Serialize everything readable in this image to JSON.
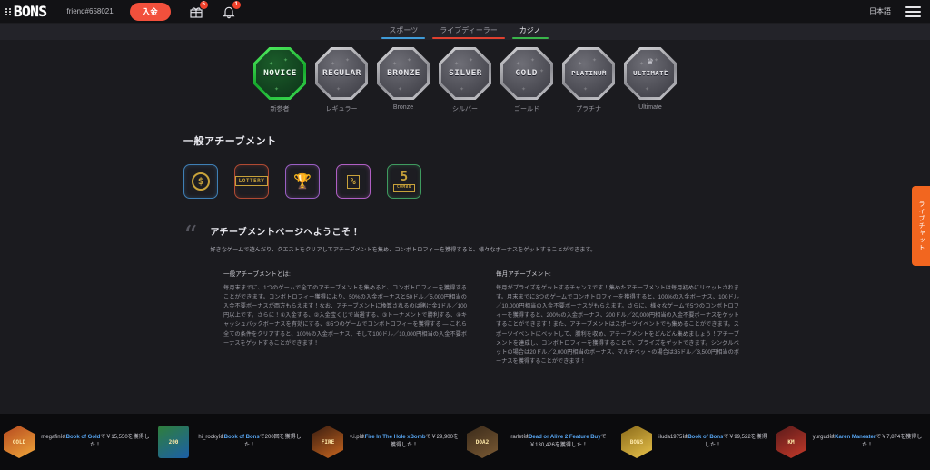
{
  "topbar": {
    "brand": "BONS",
    "friend_id": "friend#658021",
    "deposit_label": "入金",
    "gift_icon": "gift-icon",
    "gift_badge": "5",
    "bell_icon": "bell-icon",
    "bell_badge": "1",
    "language": "日本語",
    "menu_icon": "hamburger-menu-icon"
  },
  "nav": {
    "tabs": [
      {
        "label": "スポーツ",
        "color": "#3f9bd8",
        "active": false
      },
      {
        "label": "ライブディーラー",
        "color": "#e0402f",
        "active": false
      },
      {
        "label": "カジノ",
        "color": "#39b54a",
        "active": true
      }
    ]
  },
  "ranks": [
    {
      "badge": "NOVICE",
      "name": "新参者",
      "active": true
    },
    {
      "badge": "REGULAR",
      "name": "レギュラー",
      "active": false
    },
    {
      "badge": "BRONZE",
      "name": "Bronze",
      "active": false
    },
    {
      "badge": "SILVER",
      "name": "シルバー",
      "active": false
    },
    {
      "badge": "GOLD",
      "name": "ゴールド",
      "active": false
    },
    {
      "badge": "PLATINUM",
      "name": "プラチナ",
      "active": false
    },
    {
      "badge": "ULTIMATE",
      "name": "Ultimate",
      "active": false
    }
  ],
  "achievements": {
    "title": "一般アチーブメント",
    "items": [
      {
        "name": "deposit-achievement",
        "glyph": "$",
        "caption": "",
        "color": "#3f7fb5"
      },
      {
        "name": "lottery-achievement",
        "glyph": "",
        "caption": "LOTTERY",
        "color": "#b04a33"
      },
      {
        "name": "tournament-achievement",
        "glyph": "1",
        "caption": "",
        "color": "#9b5fc4"
      },
      {
        "name": "cashback-achievement",
        "glyph": "%",
        "caption": "",
        "color": "#b05fc4"
      },
      {
        "name": "combo-achievement",
        "glyph": "5",
        "caption": "COMBO",
        "color": "#3f9b5f"
      }
    ]
  },
  "intro": {
    "quote_mark": "“",
    "title": "アチーブメントページへようこそ！",
    "subtitle": "好きなゲームで遊んだり、クエストをクリアしてアチーブメントを集め、コンボトロフィーを獲得すると、様々なボーナスをゲットすることができます。"
  },
  "columns": [
    {
      "heading": "一般アチーブメントとは:",
      "body": "毎月末までに、1つのゲームで全てのアチーブメントを集めると、コンボトロフィーを獲得することができます。コンボトロフィー獲得により、50%の入金ボーナスと50ドル／5,000円相当の入金不要ボーナスが両方もらえます！なお、アチーブメントに換算されるのは賭け金1ドル／100円以上です。さらに！①入金する、②入金宝くじで当選する、③トーナメントで勝利する、④キャッシュバックボーナスを有効にする、⑤5つのゲームでコンボトロフィーを獲得する ― これら全ての条件をクリアすると、100%の入金ボーナス、そして100ドル／10,000円相当の入金不要ボーナスをゲットすることができます！"
    },
    {
      "heading": "毎月アチーブメント:",
      "body": "毎月がプライズをゲットするチャンスです！集めたアチーブメントは毎月初めにリセットされます。月末までに3つのゲームでコンボトロフィーを獲得すると、100%の入金ボーナス、100ドル／10,000円相当の入金不要ボーナスがもらえます。さらに、様々なゲームで5つのコンボトロフィーを獲得すると、200%の入金ボーナス、200ドル／20,000円相当の入金不要ボーナスをゲットすることができます！また、アチーブメントはスポーツイベントでも集めることができます。スポーツイベントにベットして、勝利を収め、アチーブメントをどんどん集めましょう！アチーブメントを達成し、コンボトロフィーを獲得することで、プライズをゲットできます。シングルベットの場合は20ドル／2,000円相当のボーナス、マルチベットの場合は35ドル／3,500円相当のボーナスを獲得することができます！"
    }
  ],
  "side_tab": {
    "label": "ライブチャット"
  },
  "winners": [
    {
      "user": "megafin",
      "joiner": "は",
      "game": "Book of Gold",
      "tail": "で",
      "amount": "￥15,550",
      "suffix": "を獲得した！",
      "thumb": "GOLD",
      "shape": "hex",
      "bg1": "#b5491f",
      "bg2": "#f0a73a"
    },
    {
      "user": "hi_rocky",
      "joiner": "は",
      "game": "Book of Bons",
      "tail": "で",
      "amount": "200回",
      "suffix": "を獲得した！",
      "thumb": "200",
      "shape": "sq",
      "bg1": "#2f7f3a",
      "bg2": "#1c5fa8"
    },
    {
      "user": "v.i.p",
      "joiner": "は",
      "game": "Fire In The Hole xBomb",
      "tail": "で",
      "amount": "￥29,900",
      "suffix": "を獲得した！",
      "thumb": "FIRE",
      "shape": "hex",
      "bg1": "#3a1d10",
      "bg2": "#c8661f"
    },
    {
      "user": "rarlet",
      "joiner": "は",
      "game": "Dead or Alive 2 Feature Buy",
      "tail": "で",
      "amount": "￥130,426",
      "suffix": "を獲得した！",
      "thumb": "DOA2",
      "shape": "hex",
      "bg1": "#3a2a1a",
      "bg2": "#7a5a34"
    },
    {
      "user": "iluda1975",
      "joiner": "は",
      "game": "Book of Bons",
      "tail": "で",
      "amount": "￥99,522",
      "suffix": "を獲得した！",
      "thumb": "BONS",
      "shape": "hex",
      "bg1": "#8a6a1a",
      "bg2": "#e8c24a"
    },
    {
      "user": "yurgud",
      "joiner": "は",
      "game": "Karen Maneater",
      "tail": "で",
      "amount": "￥7,874",
      "suffix": "を獲得した！",
      "thumb": "KM",
      "shape": "hex",
      "bg1": "#5a1a1a",
      "bg2": "#c43a2a"
    }
  ]
}
